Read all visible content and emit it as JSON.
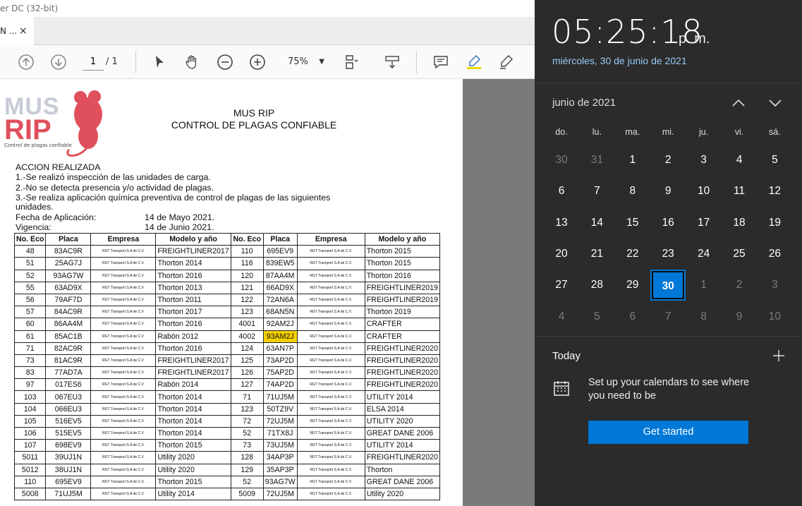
{
  "window": {
    "title": "er DC (32-bit)",
    "tab_label": "N ...",
    "tab_close": "×"
  },
  "toolbar": {
    "page_current": "1",
    "page_total": "/ 1",
    "zoom": "75%"
  },
  "document": {
    "logo_top": "MUS",
    "logo_bottom": "RIP",
    "logo_tagline": "Control de plagas confiable",
    "title1": "MUS RIP",
    "title2": "CONTROL DE PLAGAS CONFIABLE",
    "action_heading": "ACCION REALIZADA",
    "action1": "1.-Se realizó inspección de las unidades de carga.",
    "action2": "2.-No se detecta presencia y/o actividad de plagas.",
    "action3": "3.-Se realiza aplicación química preventiva de control de plagas de las siguientes",
    "action3b": "unidades.",
    "fecha_label": "Fecha de Aplicación:",
    "fecha_value": "14 de Mayo 2021.",
    "vigencia_label": "Vigencia:",
    "vigencia_value": "14 de Junio 2021.",
    "headers": [
      "No. Eco",
      "Placa",
      "Empresa",
      "Modelo y año",
      "No. Eco",
      "Placa",
      "Empresa",
      "Modelo y año"
    ],
    "empresa_text": "RGT Transport S.A de C.V.",
    "rows": [
      [
        "48",
        "83AC9R",
        "FREIGHTLINER2017",
        "110",
        "695EV9",
        "Thorton 2015"
      ],
      [
        "51",
        "25AG7J",
        "Thorton 2014",
        "116",
        "839EW5",
        "Thorton 2015"
      ],
      [
        "52",
        "93AG7W",
        "Thorton 2016",
        "120",
        "87AA4M",
        "Thorton 2016"
      ],
      [
        "55",
        "63AD9X",
        "Thorton 2013",
        "121",
        "66AD9X",
        "FREIGHTLINER2019"
      ],
      [
        "56",
        "79AF7D",
        "Thorton 2011",
        "122",
        "72AN6A",
        "FREIGHTLINER2019"
      ],
      [
        "57",
        "84AC9R",
        "Thorton 2017",
        "123",
        "68AN5N",
        "Thorton 2019"
      ],
      [
        "60",
        "86AA4M",
        "Thorton 2016",
        "4001",
        "92AM2J",
        "CRAFTER"
      ],
      [
        "61",
        "85AC1B",
        "Rabón 2012",
        "4002",
        "93AM2J",
        "CRAFTER"
      ],
      [
        "71",
        "82AC9R",
        "Thorton 2016",
        "124",
        "63AN7P",
        "FREIGHTLINER2020"
      ],
      [
        "73",
        "81AC9R",
        "FREIGHTLINER2017",
        "125",
        "73AP2D",
        "FREIGHTLINER2020"
      ],
      [
        "83",
        "77AD7A",
        "FREIGHTLINER2017",
        "126",
        "75AP2D",
        "FREIGHTLINER2020"
      ],
      [
        "97",
        "017ES6",
        "Rabón 2014",
        "127",
        "74AP2D",
        "FREIGHTLINER2020"
      ],
      [
        "103",
        "067EU3",
        "Thorton 2014",
        "71",
        "71UJ5M",
        "UTILITY 2014"
      ],
      [
        "104",
        "066EU3",
        "Thorton 2014",
        "123",
        "50TZ9V",
        "ELSA 2014"
      ],
      [
        "105",
        "516EV5",
        "Thorton 2014",
        "72",
        "72UJ5M",
        "UTILITY 2020"
      ],
      [
        "106",
        "515EV5",
        "Thorton 2014",
        "52",
        "71TX8J",
        "GREAT DANE 2006"
      ],
      [
        "107",
        "698EV9",
        "Thorton 2015",
        "73",
        "73UJ5M",
        "UTILITY 2014"
      ],
      [
        "5011",
        "39UJ1N",
        "Utility 2020",
        "128",
        "34AP3P",
        "FREIGHTLINER2020"
      ],
      [
        "5012",
        "38UJ1N",
        "Utility 2020",
        "129",
        "35AP3P",
        "Thorton"
      ],
      [
        "110",
        "695EV9",
        "Thorton 2015",
        "52",
        "93AG7W",
        "GREAT DANE 2006"
      ],
      [
        "5008",
        "71UJ5M",
        "Utility 2014",
        "5009",
        "72UJ5M",
        "Utility 2020"
      ]
    ],
    "highlight_color": "#f5d000"
  },
  "clock": {
    "time": "05:25:18",
    "ampm": "p. m.",
    "date": "miércoles, 30 de junio de 2021"
  },
  "calendar": {
    "month": "junio de 2021",
    "weekdays": [
      "do.",
      "lu.",
      "ma.",
      "mi.",
      "ju.",
      "vi.",
      "sá."
    ],
    "weeks": [
      [
        [
          "30",
          0
        ],
        [
          "31",
          0
        ],
        [
          "1",
          1
        ],
        [
          "2",
          1
        ],
        [
          "3",
          1
        ],
        [
          "4",
          1
        ],
        [
          "5",
          1
        ]
      ],
      [
        [
          "6",
          1
        ],
        [
          "7",
          1
        ],
        [
          "8",
          1
        ],
        [
          "9",
          1
        ],
        [
          "10",
          1
        ],
        [
          "11",
          1
        ],
        [
          "12",
          1
        ]
      ],
      [
        [
          "13",
          1
        ],
        [
          "14",
          1
        ],
        [
          "15",
          1
        ],
        [
          "16",
          1
        ],
        [
          "17",
          1
        ],
        [
          "18",
          1
        ],
        [
          "19",
          1
        ]
      ],
      [
        [
          "20",
          1
        ],
        [
          "21",
          1
        ],
        [
          "22",
          1
        ],
        [
          "23",
          1
        ],
        [
          "24",
          1
        ],
        [
          "25",
          1
        ],
        [
          "26",
          1
        ]
      ],
      [
        [
          "27",
          1
        ],
        [
          "28",
          1
        ],
        [
          "29",
          1
        ],
        [
          "30",
          2
        ],
        [
          "1",
          0
        ],
        [
          "2",
          0
        ],
        [
          "3",
          0
        ]
      ],
      [
        [
          "4",
          0
        ],
        [
          "5",
          0
        ],
        [
          "6",
          0
        ],
        [
          "7",
          0
        ],
        [
          "8",
          0
        ],
        [
          "9",
          0
        ],
        [
          "10",
          0
        ]
      ]
    ],
    "accent": "#0078d7"
  },
  "agenda": {
    "today": "Today",
    "message": "Set up your calendars to see where you need to be",
    "button": "Get started"
  }
}
